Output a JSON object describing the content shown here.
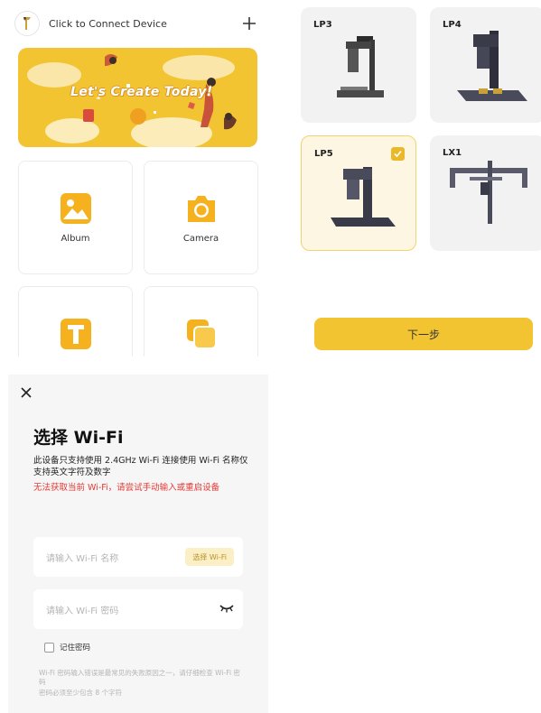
{
  "home": {
    "connect_label": "Click to Connect Device",
    "banner_text": "Let's Create Today!",
    "tiles": [
      {
        "label": "Album"
      },
      {
        "label": "Camera"
      },
      {
        "label": ""
      },
      {
        "label": ""
      }
    ]
  },
  "device_select": {
    "devices": [
      {
        "label": "LP3",
        "selected": false
      },
      {
        "label": "LP4",
        "selected": false
      },
      {
        "label": "LP5",
        "selected": true
      },
      {
        "label": "LX1",
        "selected": false
      }
    ],
    "next_label": "下一步"
  },
  "wifi": {
    "title": "选择 Wi-Fi",
    "description": "此设备只支持使用 2.4GHz Wi-Fi 连接使用 Wi-Fi 名称仅支持英文字符及数字",
    "error": "无法获取当前 Wi-Fi，请尝试手动输入或重启设备",
    "name_placeholder": "请输入 Wi-Fi 名称",
    "choose_wifi_label": "选择 Wi-Fi",
    "password_placeholder": "请输入 Wi-Fi 密码",
    "remember_label": "记住密码",
    "tip_line1": "Wi-Fi 密码输入错误是最常见的失败原因之一，请仔细检查 Wi-Fi 密码",
    "tip_line2": "密码必须至少包含 8 个字符"
  },
  "colors": {
    "accent": "#f3c431",
    "error": "#e53935",
    "selected_bg": "#fdf6e3"
  }
}
